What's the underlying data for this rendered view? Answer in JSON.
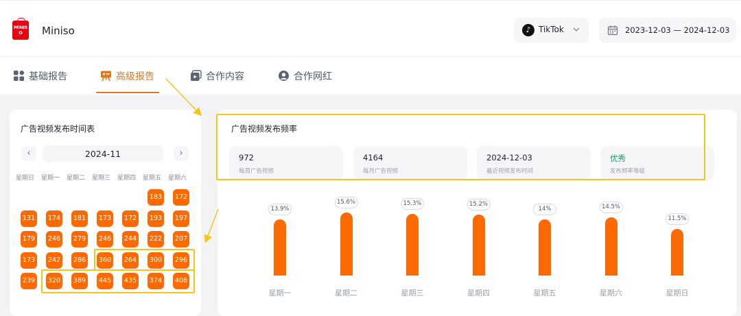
{
  "brand": {
    "logo_text": "MINISO",
    "name": "Miniso"
  },
  "platform": {
    "label": "TikTok",
    "icon": "tiktok-icon"
  },
  "date_range": {
    "start": "2023-12-03",
    "separator": "—",
    "end": "2024-12-03",
    "icon": "calendar-icon"
  },
  "tabs": [
    {
      "label": "基础报告",
      "icon": "grid-icon",
      "active": false
    },
    {
      "label": "高级报告",
      "icon": "presentation-icon",
      "active": true
    },
    {
      "label": "合作内容",
      "icon": "video-icon",
      "active": false
    },
    {
      "label": "合作网红",
      "icon": "user-icon",
      "active": false
    }
  ],
  "calendar": {
    "title": "广告视频发布时间表",
    "month": "2024-11",
    "prev": "‹",
    "next": "›",
    "weekdays": [
      "星期日",
      "星期一",
      "星期二",
      "星期三",
      "星期四",
      "星期五",
      "星期六"
    ],
    "weeks": [
      [
        null,
        null,
        null,
        null,
        null,
        "183",
        "172"
      ],
      [
        "131",
        "174",
        "181",
        "173",
        "172",
        "193",
        "197"
      ],
      [
        "179",
        "246",
        "279",
        "246",
        "244",
        "222",
        "207"
      ],
      [
        "173",
        "242",
        "286",
        "360",
        "264",
        "300",
        "296"
      ],
      [
        "239",
        "320",
        "389",
        "445",
        "435",
        "374",
        "408"
      ]
    ]
  },
  "frequency": {
    "title": "广告视频发布频率",
    "stats": [
      {
        "value": "972",
        "label": "每周广告视频"
      },
      {
        "value": "4164",
        "label": "每月广告视频"
      },
      {
        "value": "2024-12-03",
        "label": "最近视频发布时间"
      },
      {
        "value": "优秀",
        "label": "发布频率等级"
      }
    ]
  },
  "chart_data": {
    "type": "bar",
    "categories": [
      "星期一",
      "星期二",
      "星期三",
      "星期四",
      "星期五",
      "星期六",
      "星期日"
    ],
    "values": [
      13.9,
      15.6,
      15.3,
      15.2,
      14,
      14.5,
      11.5
    ],
    "labels": [
      "13.9%",
      "15.6%",
      "15.3%",
      "15.2%",
      "14%",
      "14.5%",
      "11.5%"
    ],
    "unit": "%",
    "color": "#ff6a00"
  },
  "colors": {
    "accent": "#e8741a",
    "bar": "#ff6a00",
    "highlight": "#f5c518",
    "good": "#18a058"
  }
}
